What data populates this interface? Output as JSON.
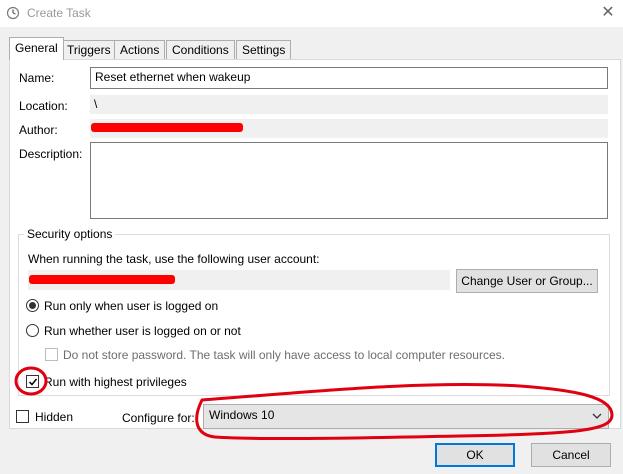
{
  "window": {
    "title": "Create Task",
    "icon": "clock-icon",
    "close_icon": "close-icon"
  },
  "tabs": [
    {
      "label": "General",
      "active": true
    },
    {
      "label": "Triggers"
    },
    {
      "label": "Actions"
    },
    {
      "label": "Conditions"
    },
    {
      "label": "Settings"
    }
  ],
  "general": {
    "name_label": "Name:",
    "name_value": "Reset ethernet when wakeup",
    "location_label": "Location:",
    "location_value": "\\",
    "author_label": "Author:",
    "description_label": "Description:",
    "description_value": ""
  },
  "security": {
    "legend": "Security options",
    "account_prompt": "When running the task, use the following user account:",
    "change_button": "Change User or Group...",
    "run_logged_on": "Run only when user is logged on",
    "run_whether": "Run whether user is logged on or not",
    "no_store_password": "Do not store password.  The task will only have access to local computer resources.",
    "highest_privileges": "Run with highest privileges",
    "selected_radio": "run_logged_on",
    "highest_checked": true
  },
  "bottom": {
    "hidden_label": "Hidden",
    "configure_label": "Configure for:",
    "configure_value": "Windows 10",
    "ok_button": "OK",
    "cancel_button": "Cancel"
  },
  "colors": {
    "annotation": "#e0000f",
    "accent": "#0078d7"
  }
}
